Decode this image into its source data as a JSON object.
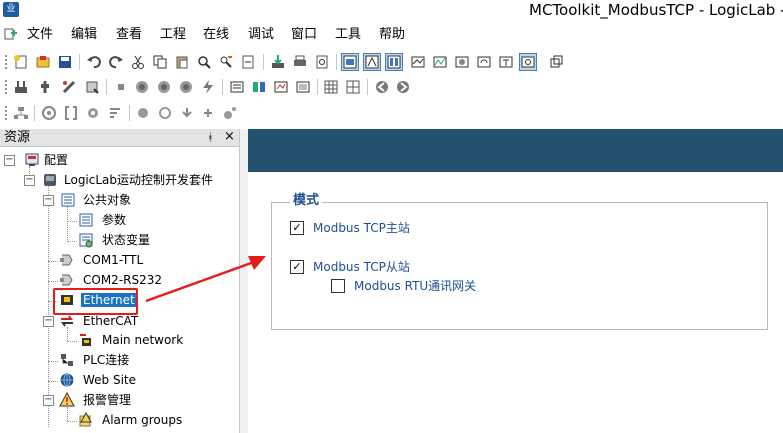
{
  "window": {
    "title": "MCToolkit_ModbusTCP - LogicLab - C:",
    "app_icon_text": "业"
  },
  "menu": {
    "items": [
      "文件",
      "编辑",
      "查看",
      "工程",
      "在线",
      "调试",
      "窗口",
      "工具",
      "帮助"
    ]
  },
  "resources_panel": {
    "title": "资源",
    "pin": "ᚼ",
    "close": "×",
    "tree": [
      {
        "label": "配置",
        "expander": "−"
      },
      {
        "label": "LogicLab运动控制开发套件",
        "expander": "−"
      },
      {
        "label": "公共对象",
        "expander": "−"
      },
      {
        "label": "参数"
      },
      {
        "label": "状态变量"
      },
      {
        "label": "COM1-TTL"
      },
      {
        "label": "COM2-RS232"
      },
      {
        "label": "Ethernet",
        "selected": true
      },
      {
        "label": "EtherCAT",
        "expander": "−"
      },
      {
        "label": "Main network"
      },
      {
        "label": "PLC连接"
      },
      {
        "label": "Web Site"
      },
      {
        "label": "报警管理",
        "expander": "−"
      },
      {
        "label": "Alarm groups"
      }
    ]
  },
  "mode_group": {
    "title": "模式",
    "options": [
      {
        "label": "Modbus TCP主站",
        "checked": true,
        "check": "✓"
      },
      {
        "label": "Modbus TCP从站",
        "checked": true,
        "check": "✓"
      },
      {
        "label": "Modbus RTU通讯网关",
        "checked": false,
        "check": ""
      }
    ]
  },
  "colors": {
    "banner": "#23516f",
    "highlight": "#e81b1b",
    "selection": "#1a73c9",
    "group_text": "#1d4f91"
  }
}
